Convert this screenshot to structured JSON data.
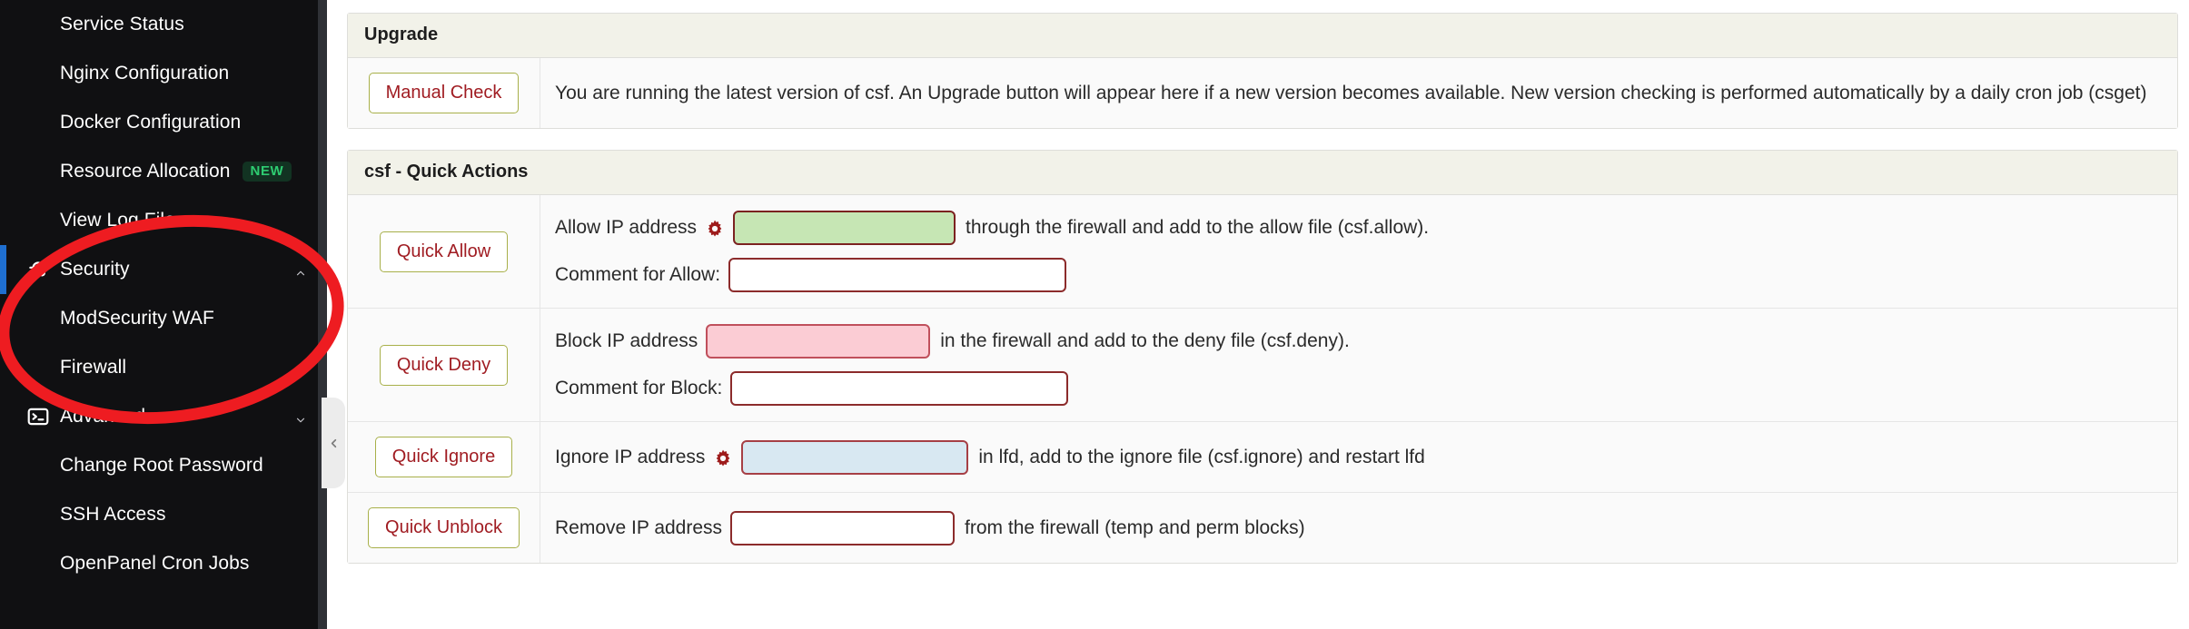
{
  "sidebar": {
    "items": [
      {
        "label": "Service Status",
        "type": "link",
        "icon": null,
        "badge": null
      },
      {
        "label": "Nginx Configuration",
        "type": "link",
        "icon": null,
        "badge": null
      },
      {
        "label": "Docker Configuration",
        "type": "link",
        "icon": null,
        "badge": null
      },
      {
        "label": "Resource Allocation",
        "type": "link",
        "icon": null,
        "badge": "NEW"
      },
      {
        "label": "View Log Files",
        "type": "link",
        "icon": null,
        "badge": null
      },
      {
        "label": "Security",
        "type": "group",
        "icon": "user-secret-icon",
        "badge": null,
        "active": true,
        "chevron": "chevron-up-icon"
      },
      {
        "label": "ModSecurity WAF",
        "type": "link",
        "icon": null,
        "badge": null
      },
      {
        "label": "Firewall",
        "type": "link",
        "icon": null,
        "badge": null
      },
      {
        "label": "Advanced",
        "type": "group",
        "icon": "terminal-icon",
        "badge": null,
        "active": false,
        "chevron": "chevron-down-icon"
      },
      {
        "label": "Change Root Password",
        "type": "link",
        "icon": null,
        "badge": null
      },
      {
        "label": "SSH Access",
        "type": "link",
        "icon": null,
        "badge": null
      },
      {
        "label": "OpenPanel Cron Jobs",
        "type": "link",
        "icon": null,
        "badge": null
      }
    ],
    "collapse_icon": "chevron-left-icon",
    "accent_color": "#1f6fd0",
    "badge_color": "#2ecc71",
    "background": "#101012"
  },
  "annotation": {
    "shape": "ellipse",
    "color": "#ee1c21",
    "note": "hand-drawn red circle around Security / ModSecurity WAF / Firewall"
  },
  "upgrade": {
    "title": "Upgrade",
    "button_label": "Manual Check",
    "message": "You are running the latest version of csf. An Upgrade button will appear here if a new version becomes available. New version checking is performed automatically by a daily cron job (csget)"
  },
  "quick_actions": {
    "title": "csf - Quick Actions",
    "rows": [
      {
        "button_label": "Quick Allow",
        "pre_label": "Allow IP address",
        "gear_icon": "gear-icon",
        "input_value": "",
        "input_placeholder": "",
        "input_style": "green",
        "post_label": "through the firewall and add to the allow file (csf.allow).",
        "comment_label": "Comment for Allow:",
        "comment_value": "",
        "comment_placeholder": ""
      },
      {
        "button_label": "Quick Deny",
        "pre_label": "Block IP address",
        "gear_icon": null,
        "input_value": "",
        "input_placeholder": "",
        "input_style": "pink",
        "post_label": "in the firewall and add to the deny file (csf.deny).",
        "comment_label": "Comment for Block:",
        "comment_value": "",
        "comment_placeholder": ""
      },
      {
        "button_label": "Quick Ignore",
        "pre_label": "Ignore IP address",
        "gear_icon": "gear-icon",
        "input_value": "",
        "input_placeholder": "",
        "input_style": "blue",
        "post_label": "in lfd, add to the ignore file (csf.ignore) and restart lfd",
        "comment_label": null,
        "comment_value": null,
        "comment_placeholder": null
      },
      {
        "button_label": "Quick Unblock",
        "pre_label": "Remove IP address",
        "gear_icon": null,
        "input_value": "",
        "input_placeholder": "",
        "input_style": "plain",
        "post_label": "from the firewall (temp and perm blocks)",
        "comment_label": null,
        "comment_value": null,
        "comment_placeholder": null
      }
    ]
  },
  "colors": {
    "panel_header_bg": "#f2f2e9",
    "button_border": "#a8b04a",
    "button_text": "#a01c22",
    "input_border": "#7b2220",
    "green_fill": "#c6e6b4",
    "pink_fill": "#fbccd4",
    "blue_fill": "#d8e8f2",
    "gear_color": "#9e1b1b"
  }
}
